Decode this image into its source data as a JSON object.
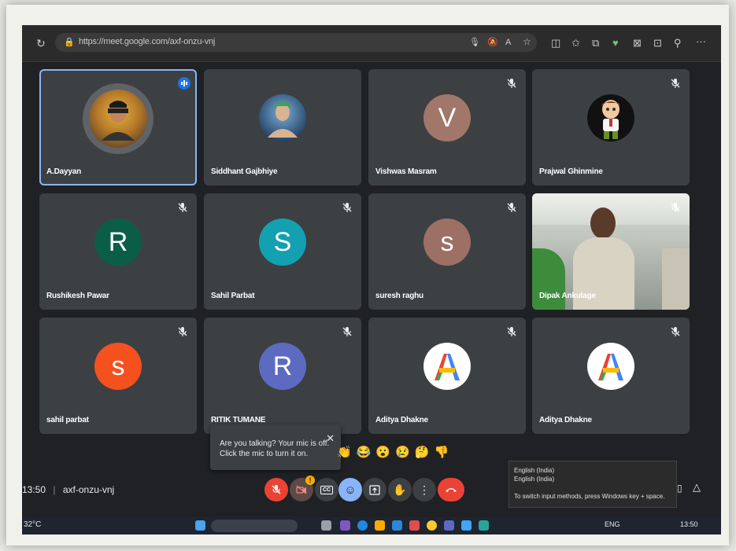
{
  "browser": {
    "url": "https://meet.google.com/axf-onzu-vnj"
  },
  "participants": [
    {
      "name": "A.Dayyan",
      "avatar_kind": "photo",
      "active": true
    },
    {
      "name": "Siddhant Gajbhiye",
      "avatar_kind": "photo"
    },
    {
      "name": "Vishwas Masram",
      "initial": "V",
      "color": "#a17769"
    },
    {
      "name": "Prajwal Ghinmine",
      "avatar_kind": "photo"
    },
    {
      "name": "Rushikesh Pawar",
      "initial": "R",
      "color": "#0b5e46"
    },
    {
      "name": "Sahil Parbat",
      "initial": "S",
      "color": "#13a1b2"
    },
    {
      "name": "suresh raghu",
      "initial": "s",
      "color": "#9c7064"
    },
    {
      "name": "Dipak Ankulage",
      "avatar_kind": "video"
    },
    {
      "name": "sahil parbat",
      "initial": "s",
      "color": "#f4511e"
    },
    {
      "name": "RITIK TUMANE",
      "initial": "R",
      "color": "#5c6bc0"
    },
    {
      "name": "Aditya Dhakne",
      "avatar_kind": "logo-A"
    },
    {
      "name": "Aditya Dhakne",
      "avatar_kind": "logo-A"
    }
  ],
  "tooltip": {
    "text_line1": "Are you talking? Your mic is off.",
    "text_line2": "Click the mic to turn it on.",
    "close": "✕"
  },
  "meeting": {
    "time": "13:50",
    "code": "axf-onzu-vnj"
  },
  "reactions": [
    "👏",
    "😂",
    "😮",
    "😢",
    "🤔",
    "👎"
  ],
  "controls": {
    "camera_badge": "!",
    "cc_label": "CC"
  },
  "ime_popup": {
    "line1": "English (India)",
    "line2": "English (India)",
    "hint": "To switch input methods, press Windows key + space."
  },
  "taskbar": {
    "weather": "32°C",
    "lang": "ENG",
    "clock": "13:50"
  },
  "colors": {
    "tile_bg": "#3c4043",
    "mic_off_red": "#ea4335",
    "active_border": "#8ab4f8"
  }
}
